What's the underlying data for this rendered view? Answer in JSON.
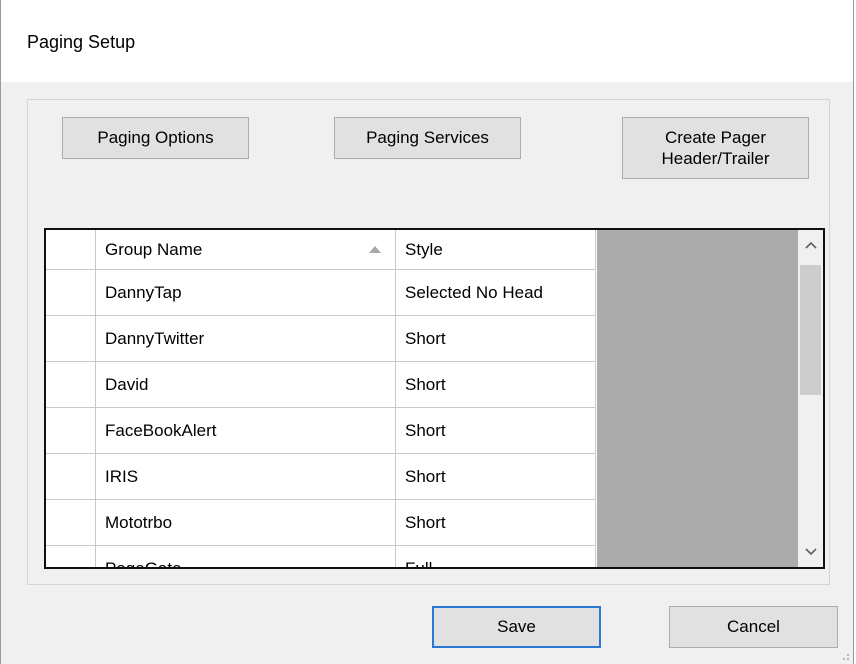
{
  "window": {
    "title": "Paging Setup"
  },
  "toolbar": {
    "paging_options_label": "Paging Options",
    "paging_services_label": "Paging Services",
    "create_header_trailer_label": "Create Pager\nHeader/Trailer"
  },
  "grid": {
    "columns": {
      "group_name": "Group Name",
      "style": "Style"
    },
    "sort": {
      "column": "group_name",
      "direction": "ascending"
    },
    "rows": [
      {
        "group_name": "DannyTap",
        "style": "Selected No Head"
      },
      {
        "group_name": "DannyTwitter",
        "style": "Short"
      },
      {
        "group_name": "David",
        "style": "Short"
      },
      {
        "group_name": "FaceBookAlert",
        "style": "Short"
      },
      {
        "group_name": "IRIS",
        "style": "Short"
      },
      {
        "group_name": "Mototrbo",
        "style": "Short"
      },
      {
        "group_name": "PageGate",
        "style": "Full"
      }
    ],
    "icons": {
      "sort": "sort-ascending-icon",
      "scroll_up": "chevron-up-icon",
      "scroll_down": "chevron-down-icon"
    }
  },
  "footer": {
    "save_label": "Save",
    "cancel_label": "Cancel"
  },
  "colors": {
    "default_button_border": "#2a78d2",
    "grid_background": "#ababab",
    "dialog_background": "#f0f0f0"
  }
}
